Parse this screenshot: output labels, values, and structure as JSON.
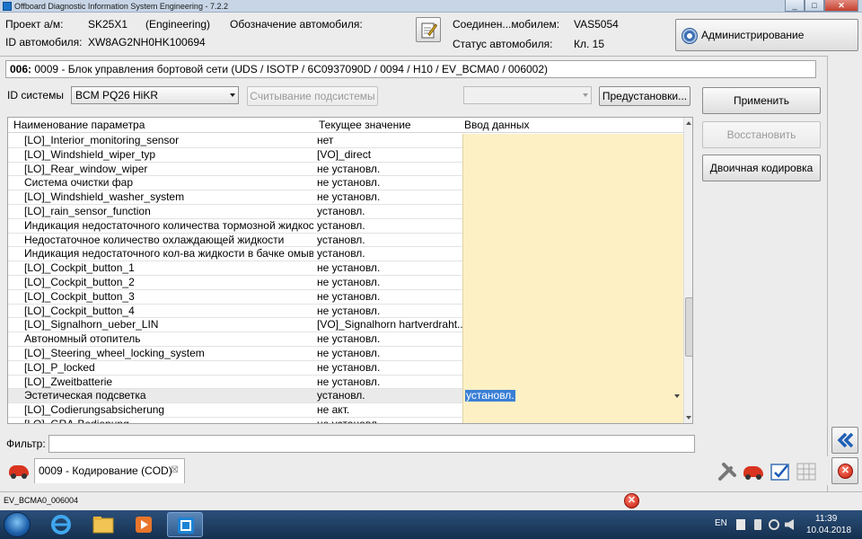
{
  "window": {
    "title": "Offboard Diagnostic Information System Engineering - 7.2.2",
    "min": "_",
    "max": "□",
    "close": "✕"
  },
  "header": {
    "project_label": "Проект а/м:",
    "project_value": "SK25X1",
    "project_mode": "(Engineering)",
    "designation_label": "Обозначение автомобиля:",
    "vehicle_id_label": "ID автомобиля:",
    "vehicle_id_value": "XW8AG2NH0HK100694",
    "connection_label": "Соединен...мобилем:",
    "connection_value": "VAS5054",
    "status_label": "Статус автомобиля:",
    "status_value": "Кл. 15",
    "admin_button": "Администрирование"
  },
  "ecu": {
    "number": "006:",
    "title": " 0009 - Блок управления бортовой сети  (UDS / ISOTP / 6C0937090D / 0094 / H10 / EV_BCMA0 / 006002)"
  },
  "system": {
    "label": "ID системы",
    "selected": "BCM PQ26 HiKR",
    "read_subsystem_button": "Считывание подсистемы",
    "presets_button": "Предустановки...",
    "second_combo_value": ""
  },
  "actions": {
    "apply": "Применить",
    "restore": "Восстановить",
    "binary_coding": "Двоичная кодировка"
  },
  "table": {
    "columns": [
      "Наименование параметра",
      "Текущее значение",
      "Ввод данных"
    ],
    "rows": [
      {
        "name": "[LO]_Interior_monitoring_sensor",
        "value": "нет",
        "input": ""
      },
      {
        "name": "[LO]_Windshield_wiper_typ",
        "value": "[VO]_direct",
        "input": ""
      },
      {
        "name": "[LO]_Rear_window_wiper",
        "value": "не установл.",
        "input": ""
      },
      {
        "name": "Система очистки фар",
        "value": "не установл.",
        "input": ""
      },
      {
        "name": "[LO]_Windshield_washer_system",
        "value": "не установл.",
        "input": ""
      },
      {
        "name": "[LO]_rain_sensor_function",
        "value": "установл.",
        "input": ""
      },
      {
        "name": "Индикация недостаточного количества тормозной жидкости",
        "value": "установл.",
        "input": ""
      },
      {
        "name": "Недостаточное количество охлаждающей жидкости",
        "value": "установл.",
        "input": ""
      },
      {
        "name": "Индикация недостаточного кол-ва жидкости в бачке омывателя",
        "value": "установл.",
        "input": ""
      },
      {
        "name": "[LO]_Cockpit_button_1",
        "value": "не установл.",
        "input": ""
      },
      {
        "name": "[LO]_Cockpit_button_2",
        "value": "не установл.",
        "input": ""
      },
      {
        "name": "[LO]_Cockpit_button_3",
        "value": "не установл.",
        "input": ""
      },
      {
        "name": "[LO]_Cockpit_button_4",
        "value": "не установл.",
        "input": ""
      },
      {
        "name": "[LO]_Signalhorn_ueber_LIN",
        "value": "[VO]_Signalhorn hartverdraht...",
        "input": ""
      },
      {
        "name": "Автономный отопитель",
        "value": "не установл.",
        "input": ""
      },
      {
        "name": "[LO]_Steering_wheel_locking_system",
        "value": "не установл.",
        "input": ""
      },
      {
        "name": "[LO]_P_locked",
        "value": "не установл.",
        "input": ""
      },
      {
        "name": "[LO]_Zweitbatterie",
        "value": "не установл.",
        "input": ""
      },
      {
        "name": "Эстетическая подсветка",
        "value": "установл.",
        "input": "установл.",
        "selected": true
      },
      {
        "name": "[LO]_Codierungsabsicherung",
        "value": "не акт.",
        "input": ""
      },
      {
        "name": "[LO]_GRA-Bedienung",
        "value": "не установл.",
        "input": ""
      }
    ]
  },
  "filter": {
    "label": "Фильтр:",
    "value": ""
  },
  "tabs": [
    {
      "label": "0009 - Кодирование (COD)",
      "close": "☒"
    }
  ],
  "statusbar": {
    "text": "EV_BCMA0_006004"
  },
  "taskbar": {
    "lang": "EN",
    "time": "11:39",
    "date": "10.04.2018"
  },
  "icons": {
    "edit": "edit-note-icon",
    "gear": "gear-icon",
    "car": "car-icon",
    "tools": "tools-icon",
    "checklist": "checklist-icon",
    "grid": "grid-icon",
    "back": "double-chevron-left-icon",
    "cancel": "cancel-icon",
    "error": "error-icon"
  },
  "colors": {
    "input_cell": "#fdf0c4",
    "selection": "#3a7fd5",
    "error": "#c41b0b"
  }
}
